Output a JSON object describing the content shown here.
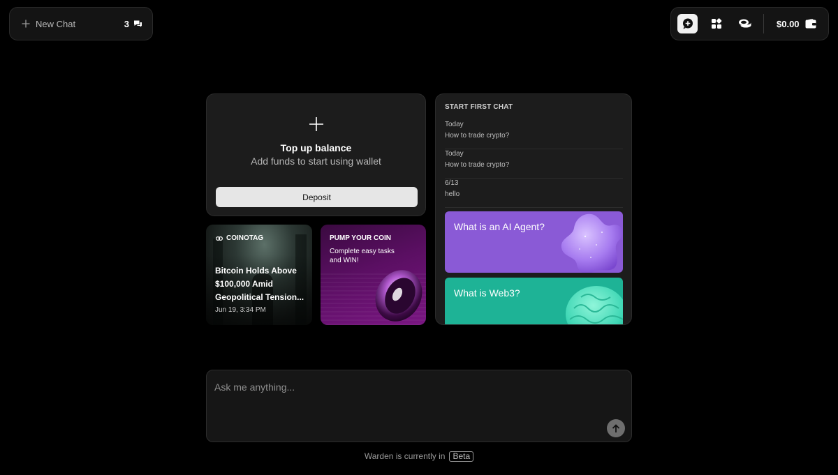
{
  "header": {
    "new_chat_label": "New Chat",
    "chat_count": "3",
    "balance": "$0.00"
  },
  "topup": {
    "title": "Top up balance",
    "subtitle": "Add funds to start using wallet",
    "deposit_label": "Deposit"
  },
  "news_card": {
    "brand": "COINOTAG",
    "headline": "Bitcoin Holds Above $100,000 Amid Geopolitical Tension...",
    "date": "Jun 19, 3:34 PM"
  },
  "pump_card": {
    "title": "PUMP YOUR COIN",
    "subtitle": "Complete easy tasks and WIN!"
  },
  "history": {
    "heading": "START FIRST CHAT",
    "items": [
      {
        "date": "Today",
        "question": "How to trade crypto?"
      },
      {
        "date": "Today",
        "question": "How to trade crypto?"
      },
      {
        "date": "6/13",
        "question": "hello"
      }
    ],
    "promos": [
      {
        "label": "What is an AI Agent?",
        "color": "#8a5ad6"
      },
      {
        "label": "What is Web3?",
        "color": "#1eb396"
      }
    ]
  },
  "input": {
    "placeholder": "Ask me anything..."
  },
  "footer": {
    "text": "Warden is currently in",
    "badge": "Beta"
  },
  "icons": {
    "new_chat": "plus-icon",
    "chat_count": "chat-bubbles-icon",
    "toolbar": [
      "chat-plus-icon",
      "apps-grid-icon",
      "coins-icon"
    ],
    "wallet": "wallet-icon",
    "send": "arrow-up-icon"
  }
}
